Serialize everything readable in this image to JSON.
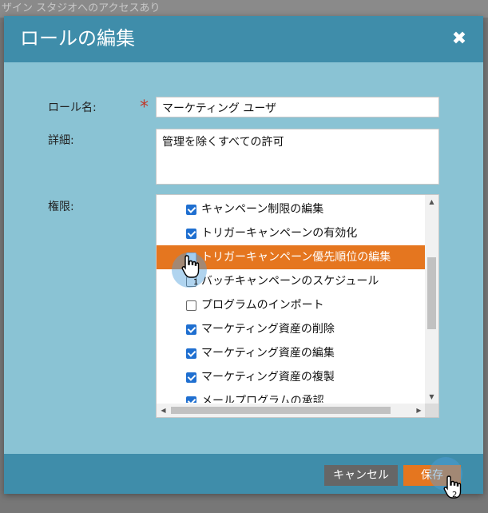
{
  "background": {
    "text": "ザイン スタジオへのアクセスあり"
  },
  "dialog": {
    "title": "ロールの編集",
    "close_glyph": "✖",
    "labels": {
      "role_name": "ロール名:",
      "details": "詳細:",
      "permissions": "権限:"
    },
    "required_mark": "*",
    "role_name_value": "マーケティング ユーザ",
    "details_value": "管理を除くすべての許可",
    "permissions": [
      {
        "label": "キャンペーン制限の編集",
        "checked": true
      },
      {
        "label": "トリガーキャンペーンの有効化",
        "checked": true
      },
      {
        "label": "トリガーキャンペーン優先順位の編集",
        "checked": false,
        "highlighted": true
      },
      {
        "label": "バッチキャンペーンのスケジュール",
        "checked": false
      },
      {
        "label": "プログラムのインポート",
        "checked": false
      },
      {
        "label": "マーケティング資産の削除",
        "checked": true
      },
      {
        "label": "マーケティング資産の編集",
        "checked": true
      },
      {
        "label": "マーケティング資産の複製",
        "checked": true
      },
      {
        "label": "メールプログラムの承認",
        "checked": true
      }
    ],
    "buttons": {
      "cancel": "キャンセル",
      "save": "保存"
    }
  },
  "cursors": {
    "step1": "1",
    "step2": "2"
  },
  "colors": {
    "header": "#3f8daa",
    "body": "#8ac3d4",
    "accent": "#e5761f",
    "cancel": "#666666"
  }
}
